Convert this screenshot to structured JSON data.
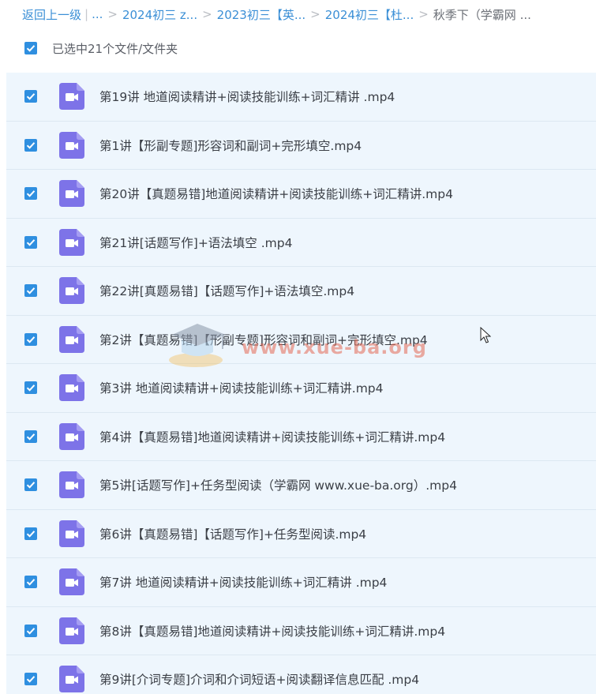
{
  "breadcrumb": {
    "back": "返回上一级",
    "ellipsis": "...",
    "items": [
      "2024初三 z...",
      "2023初三【英...",
      "2024初三【杜..."
    ],
    "current": "秋季下（学霸网 ..."
  },
  "selection": {
    "text": "已选中21个文件/文件夹",
    "checked": true
  },
  "files": [
    {
      "name": "第19讲 地道阅读精讲+阅读技能训练+词汇精讲 .mp4",
      "checked": true
    },
    {
      "name": "第1讲【形副专题]形容词和副词+完形填空.mp4",
      "checked": true
    },
    {
      "name": "第20讲【真题易错]地道阅读精讲+阅读技能训练+词汇精讲.mp4",
      "checked": true
    },
    {
      "name": "第21讲[话题写作]+语法填空 .mp4",
      "checked": true
    },
    {
      "name": "第22讲[真题易错]【话题写作]+语法填空.mp4",
      "checked": true
    },
    {
      "name": "第2讲【真题易错]【形副专题]形容词和副词+完形填空.mp4",
      "checked": true
    },
    {
      "name": "第3讲 地道阅读精讲+阅读技能训练+词汇精讲.mp4",
      "checked": true
    },
    {
      "name": "第4讲【真题易错]地道阅读精讲+阅读技能训练+词汇精讲.mp4",
      "checked": true
    },
    {
      "name": "第5讲[话题写作]+任务型阅读（学霸网 www.xue-ba.org）.mp4",
      "checked": true
    },
    {
      "name": "第6讲【真题易错]【话题写作]+任务型阅读.mp4",
      "checked": true
    },
    {
      "name": "第7讲 地道阅读精讲+阅读技能训练+词汇精讲 .mp4",
      "checked": true
    },
    {
      "name": "第8讲【真题易错]地道阅读精讲+阅读技能训练+词汇精讲.mp4",
      "checked": true
    },
    {
      "name": "第9讲[介词专题]介词和介词短语+阅读翻译信息匹配 .mp4",
      "checked": true
    }
  ],
  "watermark": {
    "text": "www.xue-ba.org"
  },
  "colors": {
    "accent": "#2f8fe0",
    "link": "#3b8fd6",
    "video_icon": "#7d73e8",
    "list_bg": "#eef6fd"
  }
}
